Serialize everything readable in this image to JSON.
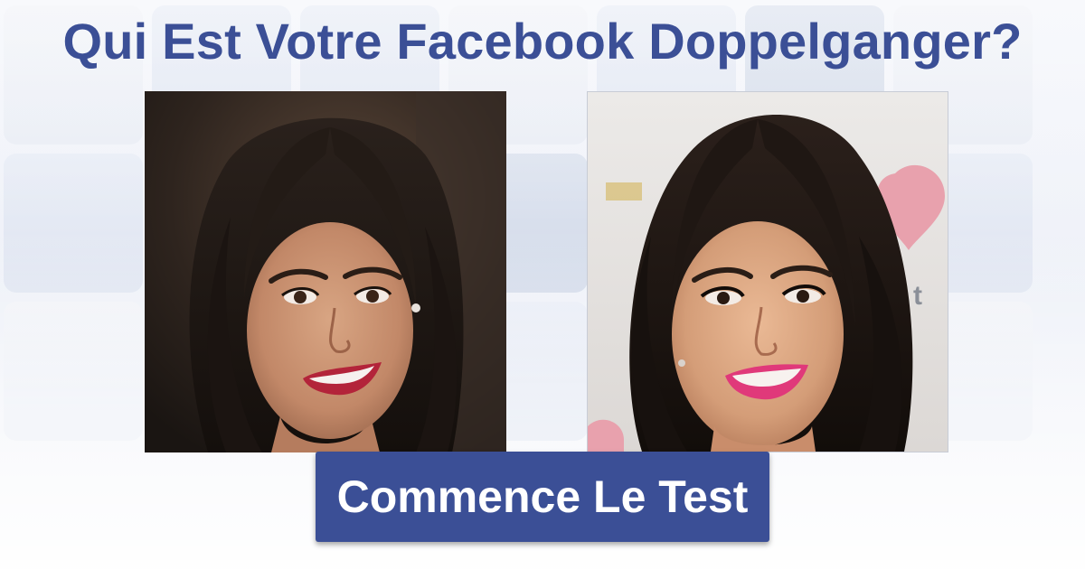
{
  "header": {
    "title": "Qui Est Votre Facebook Doppelganger?"
  },
  "photos": {
    "left": {
      "icon": "portrait-woman-dark-hair"
    },
    "right": {
      "icon": "portrait-woman-dark-hair-pink-lips"
    }
  },
  "cta": {
    "label": "Commence Le Test"
  },
  "colors": {
    "brand": "#3b4f96",
    "button_text": "#ffffff",
    "tile": "#e2e7f2"
  }
}
